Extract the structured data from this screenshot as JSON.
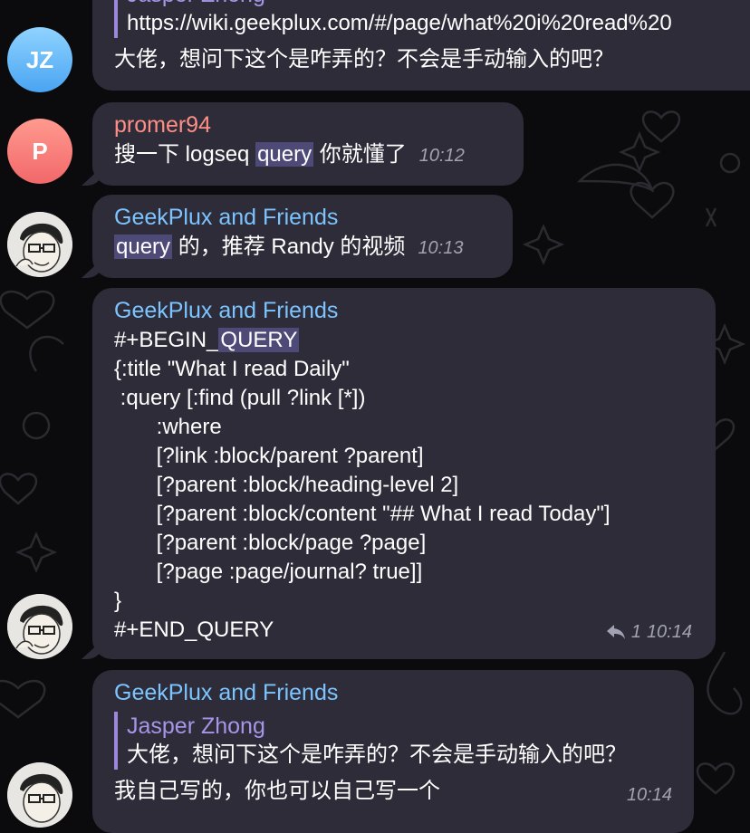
{
  "messages": [
    {
      "avatar": "JZ",
      "sender": "Jasper Zhong",
      "reply_link": "https://wiki.geekplux.com/#/page/what%20i%20read%20",
      "text": "大佬，想问下这个是咋弄的？不会是手动输入的吧？"
    },
    {
      "avatar": "P",
      "sender": "promer94",
      "text_before": "搜一下 logseq ",
      "highlight": "query",
      "text_after": " 你就懂了",
      "time": "10:12"
    },
    {
      "sender": "GeekPlux and Friends",
      "highlight": "query",
      "text_after": " 的，推荐 Randy 的视频",
      "time": "10:13"
    },
    {
      "sender": "GeekPlux and Friends",
      "code_first_prefix": "#+BEGIN_",
      "code_first_highlight": "QUERY",
      "code_lines": [
        "{:title \"What I read Daily\"",
        " :query [:find (pull ?link [*])",
        "       :where",
        "       [?link :block/parent ?parent]",
        "       [?parent :block/heading-level 2]",
        "       [?parent :block/content \"## What I read Today\"]",
        "       [?parent :block/page ?page]",
        "       [?page :page/journal? true]]",
        "}",
        "#+END_QUERY"
      ],
      "reply_count": "1",
      "time": "10:14"
    },
    {
      "sender": "GeekPlux and Friends",
      "reply_name": "Jasper Zhong",
      "reply_text": "大佬，想问下这个是咋弄的？不会是手动输入的吧？",
      "text": "我自己写的，你也可以自己写一个",
      "time": "10:14"
    }
  ],
  "icons": {
    "reply": "reply-arrow-icon"
  },
  "colors": {
    "background": "#0b0b0d",
    "bubble": "#2d2c38",
    "sender_blue": "#7cc4ff",
    "sender_red": "#ff8f86",
    "reply_bar": "#9b88d8",
    "highlight": "#4e4a78"
  }
}
